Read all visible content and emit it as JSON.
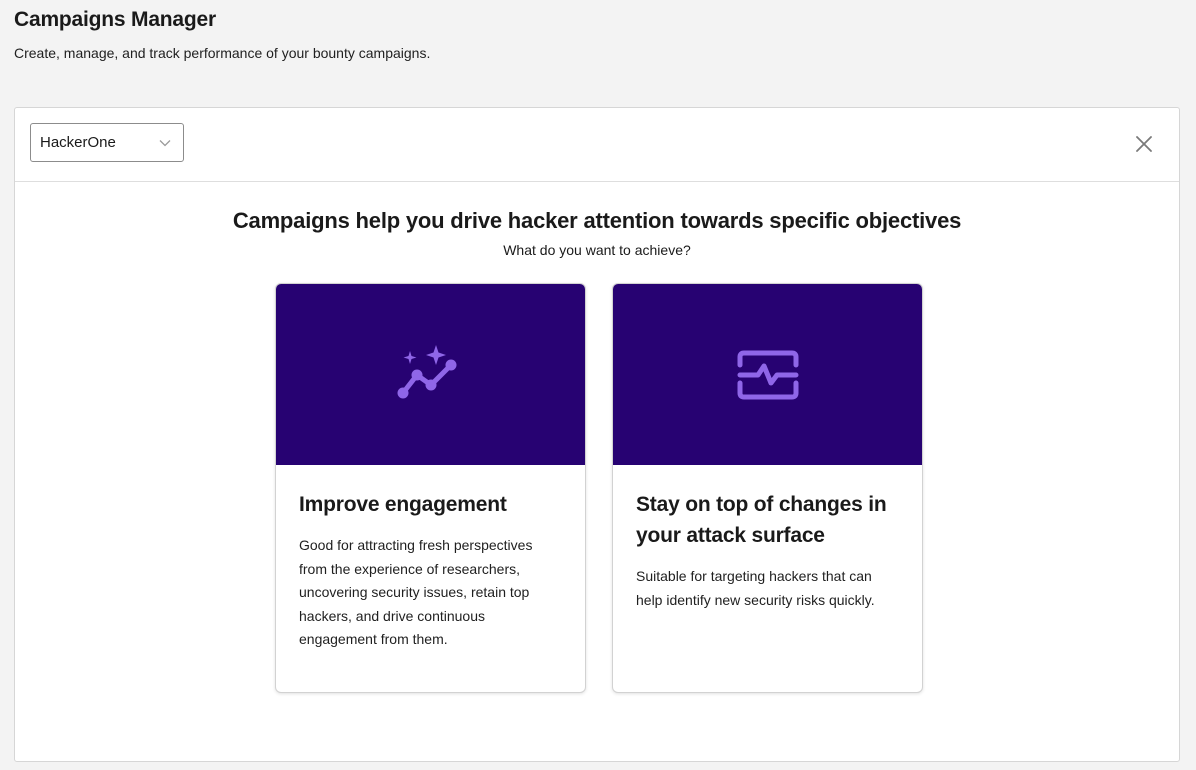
{
  "header": {
    "title": "Campaigns Manager",
    "subtitle": "Create, manage, and track performance of your bounty campaigns."
  },
  "toolbar": {
    "program_select": {
      "value": "HackerOne",
      "icon": "chevron-down-icon"
    },
    "close_icon": "close-icon"
  },
  "intro": {
    "title": "Campaigns help you drive hacker attention towards specific objectives",
    "subtitle": "What do you want to achieve?"
  },
  "cards": [
    {
      "icon": "sparkle-trend-icon",
      "title": "Improve engagement",
      "description": "Good for attracting fresh perspectives from the experience of researchers, uncovering security issues, retain top hackers, and drive continuous engagement from them."
    },
    {
      "icon": "activity-monitor-icon",
      "title": "Stay on top of changes in your attack surface",
      "description": "Suitable for targeting hackers that can help identify new security risks quickly."
    }
  ],
  "colors": {
    "card_hero_background": "#270272",
    "icon_accent": "#8f66e8",
    "page_background": "#f3f3f3"
  }
}
